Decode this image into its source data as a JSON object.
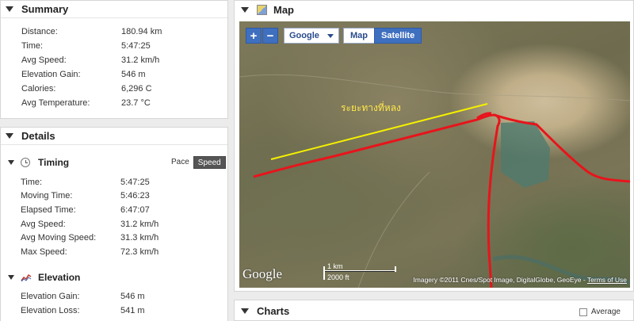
{
  "summary": {
    "title": "Summary",
    "rows": [
      {
        "label": "Distance:",
        "value": "180.94 km"
      },
      {
        "label": "Time:",
        "value": "5:47:25"
      },
      {
        "label": "Avg Speed:",
        "value": "31.2 km/h"
      },
      {
        "label": "Elevation Gain:",
        "value": "546 m"
      },
      {
        "label": "Calories:",
        "value": "6,296 C"
      },
      {
        "label": "Avg Temperature:",
        "value": "23.7 °C"
      }
    ]
  },
  "details": {
    "title": "Details",
    "timing": {
      "title": "Timing",
      "pace_label": "Pace",
      "speed_label": "Speed",
      "rows": [
        {
          "label": "Time:",
          "value": "5:47:25"
        },
        {
          "label": "Moving Time:",
          "value": "5:46:23"
        },
        {
          "label": "Elapsed Time:",
          "value": "6:47:07"
        },
        {
          "label": "Avg Speed:",
          "value": "31.2 km/h"
        },
        {
          "label": "Avg Moving Speed:",
          "value": "31.3 km/h"
        },
        {
          "label": "Max Speed:",
          "value": "72.3 km/h"
        }
      ]
    },
    "elevation": {
      "title": "Elevation",
      "rows": [
        {
          "label": "Elevation Gain:",
          "value": "546 m"
        },
        {
          "label": "Elevation Loss:",
          "value": "541 m"
        }
      ]
    }
  },
  "map": {
    "title": "Map",
    "zoom_in": "+",
    "zoom_out": "−",
    "provider": "Google",
    "type_map": "Map",
    "type_satellite": "Satellite",
    "annotation": "ระยะทางที่หลง",
    "logo": "Google",
    "scale_km": "1 km",
    "scale_ft": "2000 ft",
    "attribution": "Imagery ©2011 Cnes/Spot Image, DigitalGlobe, GeoEye",
    "terms": "Terms of Use",
    "route_color": "#e8141b",
    "annotation_line_color": "#f5f000"
  },
  "charts": {
    "title": "Charts",
    "average_label": "Average"
  }
}
